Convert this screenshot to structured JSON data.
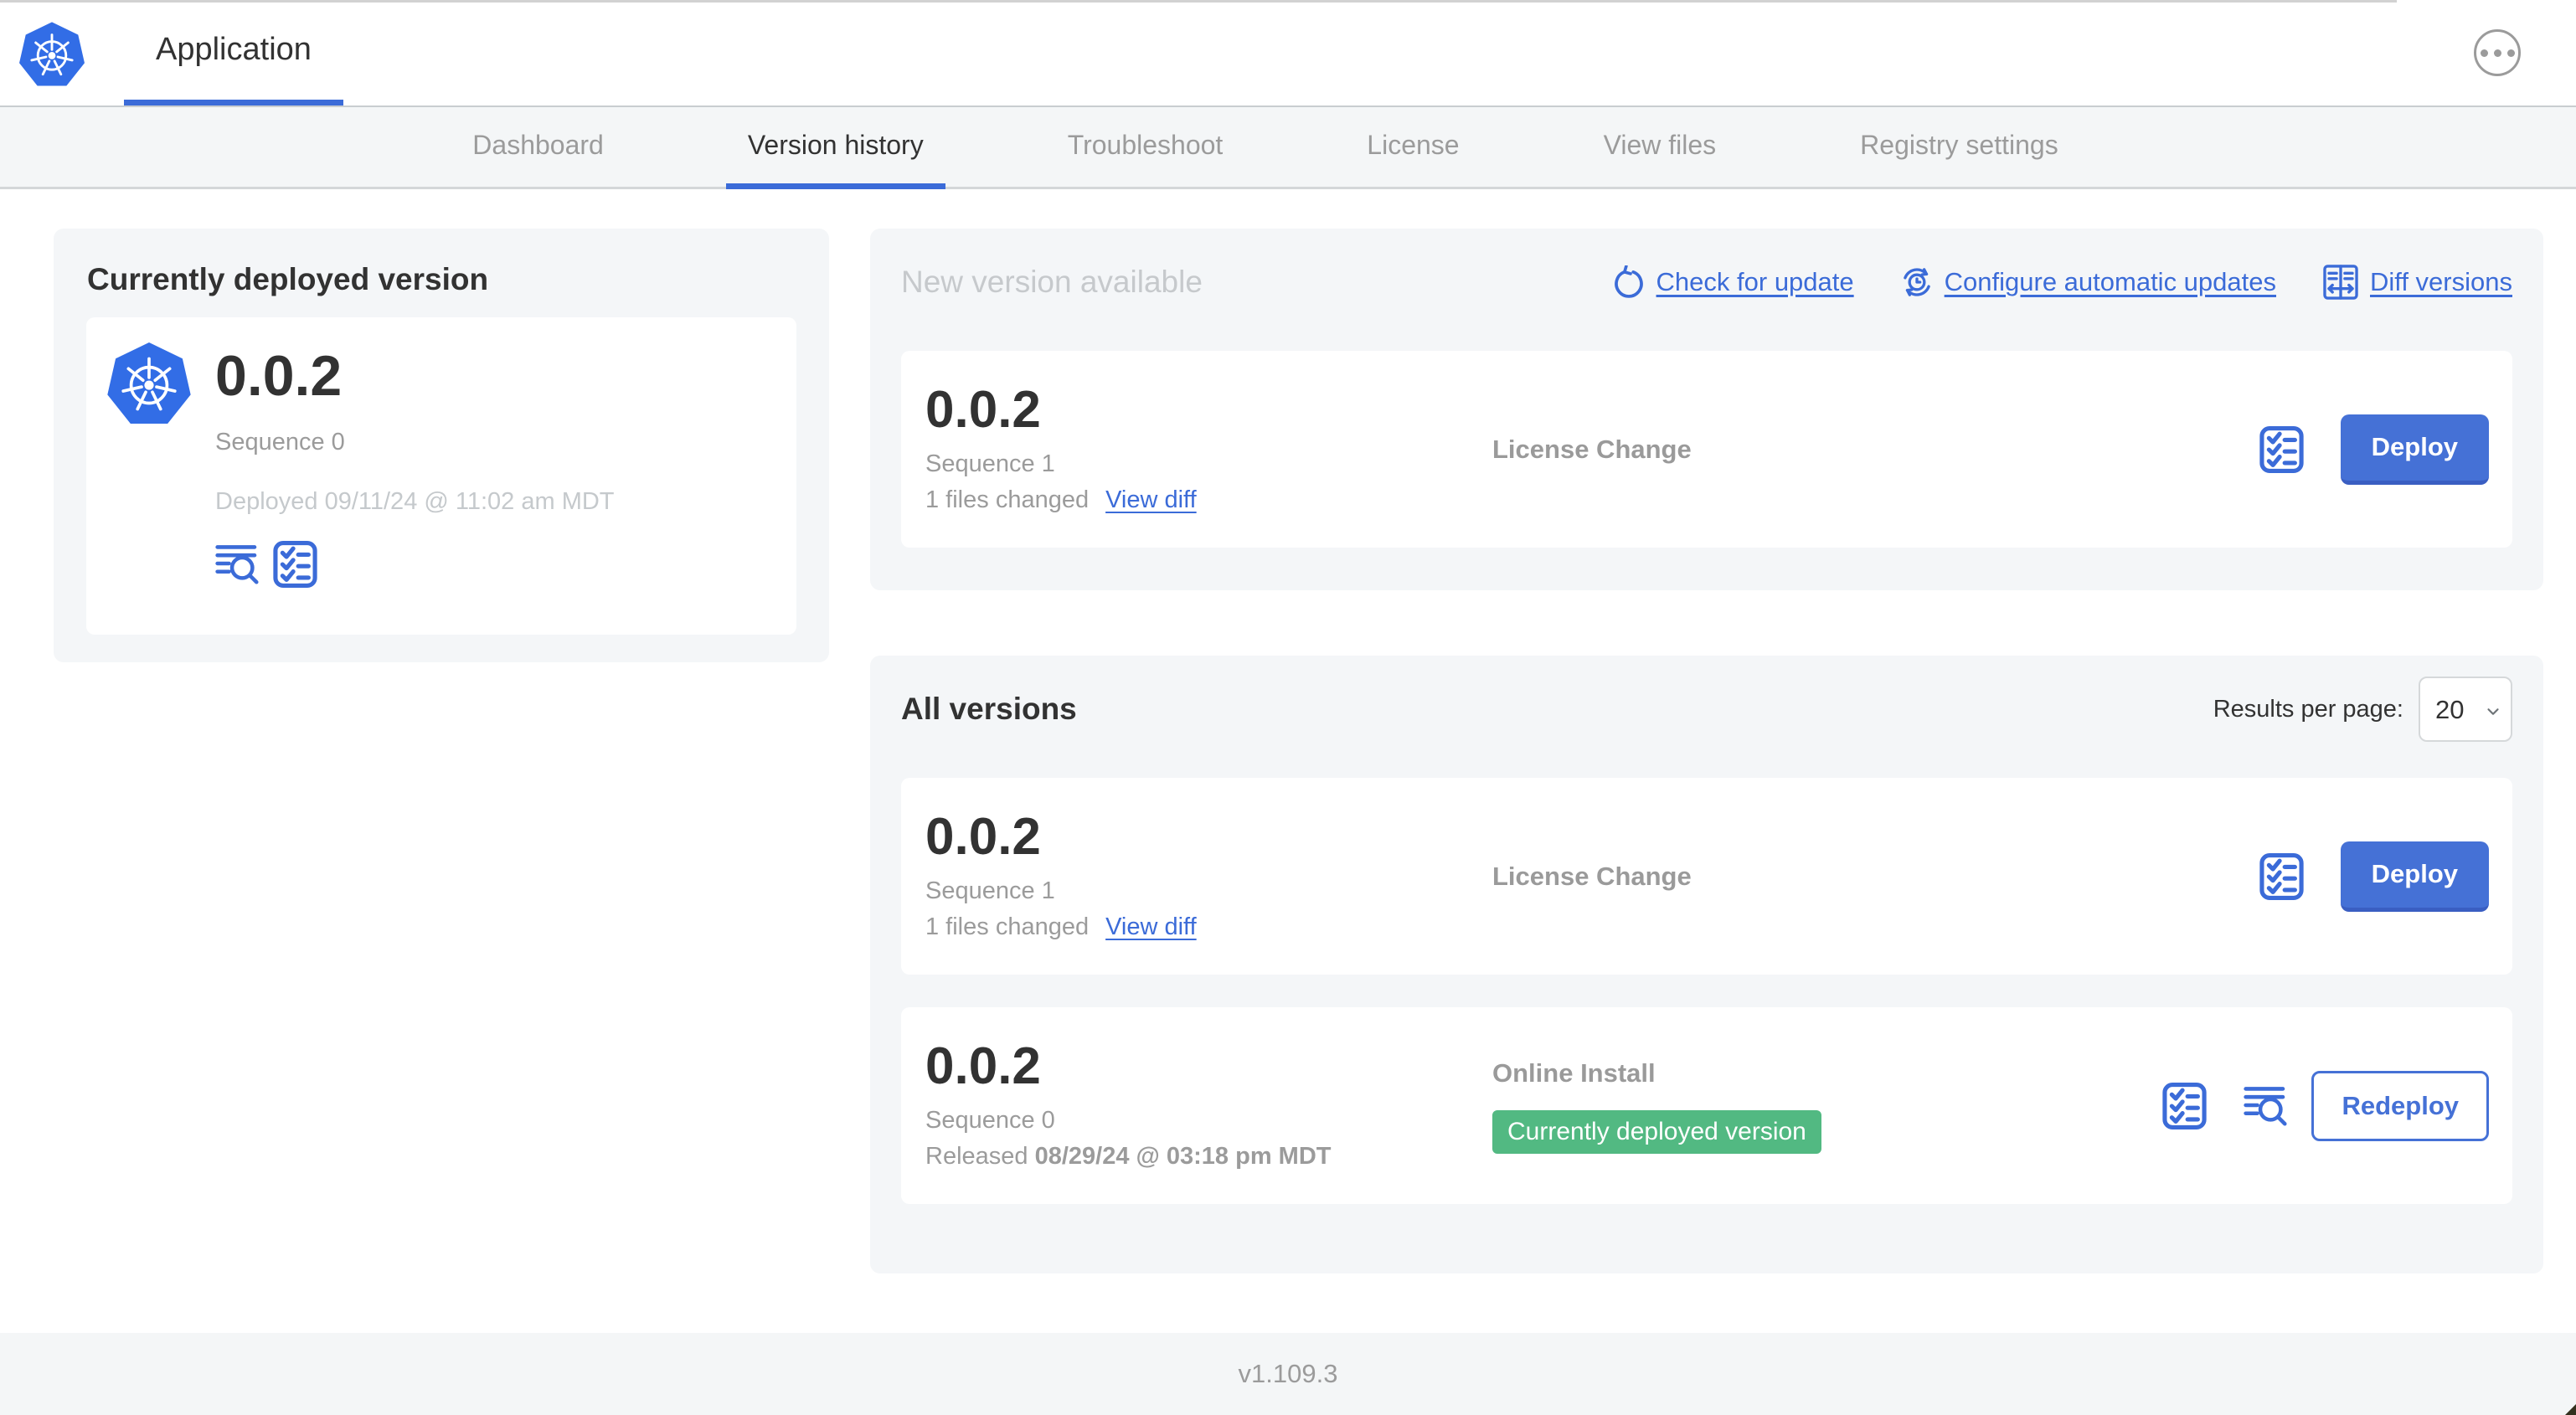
{
  "header": {
    "app_title": "Application"
  },
  "nav": {
    "tabs": [
      {
        "label": "Dashboard"
      },
      {
        "label": "Version history"
      },
      {
        "label": "Troubleshoot"
      },
      {
        "label": "License"
      },
      {
        "label": "View files"
      },
      {
        "label": "Registry settings"
      }
    ],
    "active_tab": "Version history"
  },
  "current_deployed": {
    "title": "Currently deployed version",
    "version": "0.0.2",
    "sequence": "Sequence 0",
    "deployed": "Deployed 09/11/24 @ 11:02 am MDT"
  },
  "new_version": {
    "title": "New version available",
    "actions": [
      {
        "label": "Check for update",
        "icon": "refresh-icon"
      },
      {
        "label": "Configure automatic updates",
        "icon": "clock-refresh-icon"
      },
      {
        "label": "Diff versions",
        "icon": "diff-icon"
      }
    ],
    "row": {
      "version": "0.0.2",
      "sequence": "Sequence 1",
      "files_changed": "1 files changed",
      "view_diff_label": "View diff",
      "source": "License Change",
      "action_label": "Deploy"
    }
  },
  "all_versions": {
    "title": "All versions",
    "results_per_page_label": "Results per page:",
    "results_per_page_value": "20",
    "rows": [
      {
        "version": "0.0.2",
        "sequence": "Sequence 1",
        "files_changed": "1 files changed",
        "view_diff_label": "View diff",
        "source": "License Change",
        "action_label": "Deploy"
      },
      {
        "version": "0.0.2",
        "sequence": "Sequence 0",
        "released_prefix": "Released",
        "released_date": "08/29/24 @ 03:18 pm MDT",
        "source": "Online Install",
        "badge": "Currently deployed version",
        "action_label": "Redeploy"
      }
    ]
  },
  "footer": {
    "app_version": "v1.109.3"
  },
  "colors": {
    "accent_blue": "#3b6bd8",
    "button_blue": "#4571d6",
    "badge_green": "#52b982",
    "panel_gray": "#f4f6f8",
    "nav_gray": "#f4f6f7",
    "muted_text": "#9b9b9b",
    "faint_text": "#c6c9cc",
    "dark_text": "#323232"
  }
}
